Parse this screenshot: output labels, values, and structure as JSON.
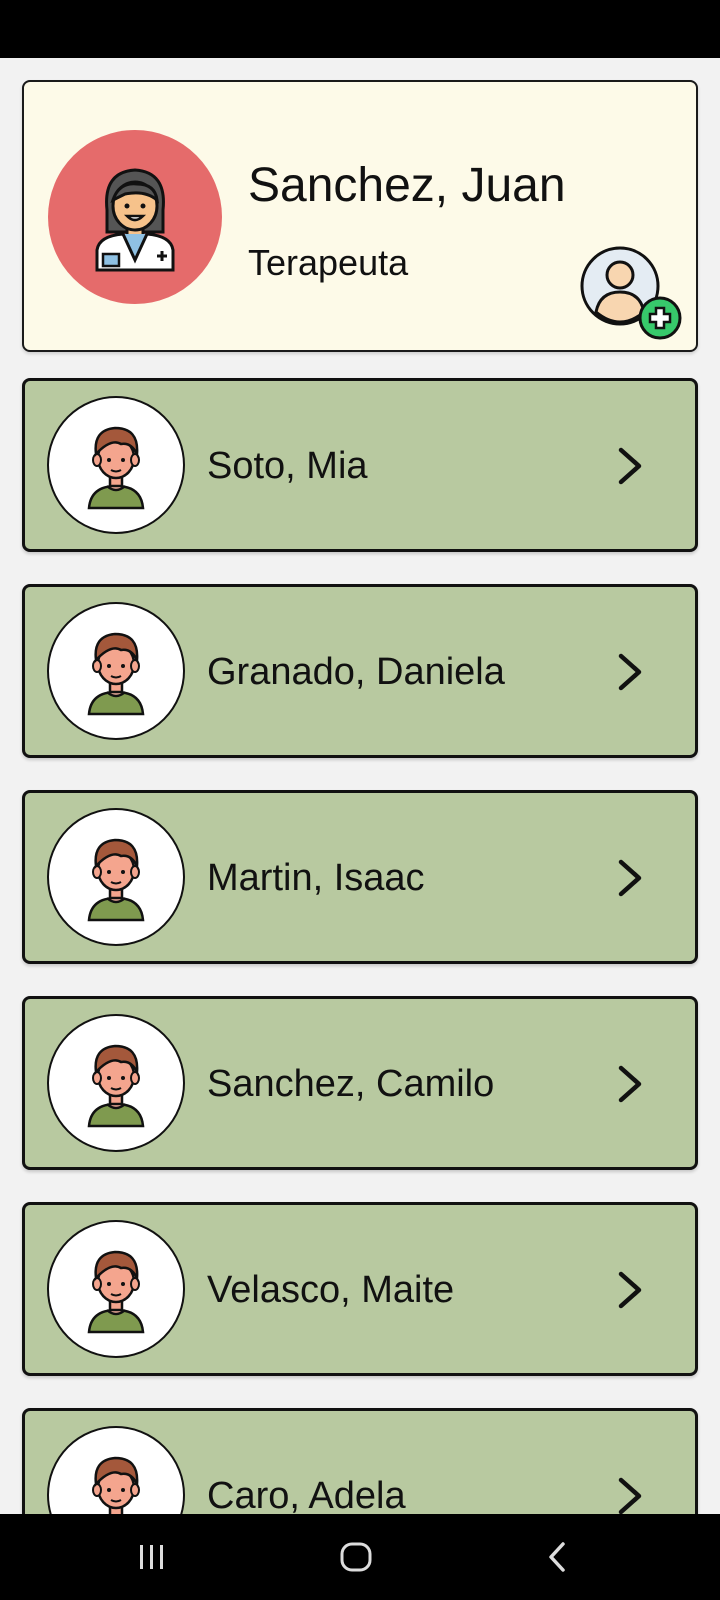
{
  "therapist": {
    "name": "Sanchez, Juan",
    "role": "Terapeuta"
  },
  "patients": [
    {
      "name": "Soto, Mia"
    },
    {
      "name": "Granado, Daniela"
    },
    {
      "name": "Martin, Isaac"
    },
    {
      "name": "Sanchez, Camilo"
    },
    {
      "name": "Velasco, Maite"
    },
    {
      "name": "Caro, Adela"
    }
  ],
  "colors": {
    "profile_card_bg": "#fdfae8",
    "profile_avatar_bg": "#e56b6b",
    "patient_card_bg": "#b8c9a0",
    "page_bg": "#f2f2f2",
    "add_badge": "#37c96b"
  },
  "icons": {
    "therapist_avatar": "doctor-avatar-icon",
    "patient_avatar": "boy-avatar-icon",
    "add_patient": "user-add-icon",
    "row_action": "chevron-right-icon",
    "nav": [
      "recent-apps-icon",
      "home-icon",
      "back-icon"
    ]
  }
}
